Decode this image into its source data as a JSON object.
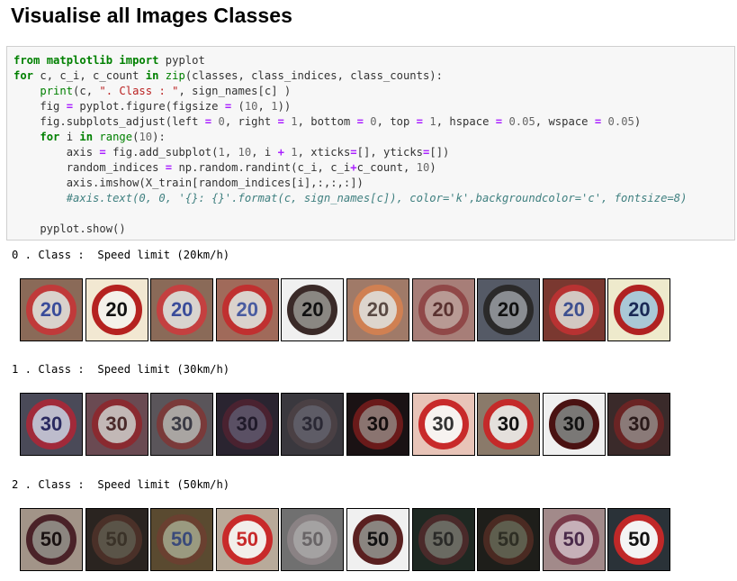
{
  "heading": "Visualise all Images Classes",
  "code_lines": [
    "from matplotlib import pyplot",
    "for c, c_i, c_count in zip(classes, class_indices, class_counts):",
    "    print(c, \". Class : \", sign_names[c] )",
    "    fig = pyplot.figure(figsize = (10, 1))",
    "    fig.subplots_adjust(left = 0, right = 1, bottom = 0, top = 1, hspace = 0.05, wspace = 0.05)",
    "    for i in range(10):",
    "        axis = fig.add_subplot(1, 10, i + 1, xticks=[], yticks=[])",
    "        random_indices = np.random.randint(c_i, c_i+c_count, 10)",
    "        axis.imshow(X_train[random_indices[i],:,:,:])",
    "        #axis.text(0, 0, '{}: {}'.format(c, sign_names[c]), color='k',backgroundcolor='c', fontsize=8)",
    "",
    "    pyplot.show()"
  ],
  "outputs": [
    {
      "text": "0 . Class :  Speed limit (20km/h)",
      "images": [
        {
          "label": "20",
          "bg": "#8a6a58",
          "ring": "#c03a3a",
          "face": "#d9d2cc",
          "fg": "#3a4c9a",
          "border": "#000000"
        },
        {
          "label": "20",
          "bg": "#f2e8d2",
          "ring": "#b52220",
          "face": "#f4f1ea",
          "fg": "#111111",
          "border": "#000000"
        },
        {
          "label": "20",
          "bg": "#8a6a58",
          "ring": "#c44040",
          "face": "#d8d4cf",
          "fg": "#3a4c9a",
          "border": "#000000"
        },
        {
          "label": "20",
          "bg": "#a06a5a",
          "ring": "#c03030",
          "face": "#dad2cc",
          "fg": "#4a5ca0",
          "border": "#000000"
        },
        {
          "label": "20",
          "bg": "#f0f0f0",
          "ring": "#3a2a28",
          "face": "#8a8782",
          "fg": "#111111",
          "border": "#000000"
        },
        {
          "label": "20",
          "bg": "#a07a68",
          "ring": "#d08052",
          "face": "#ddd5cd",
          "fg": "#5a4a44",
          "border": "#000000"
        },
        {
          "label": "20",
          "bg": "#a77e78",
          "ring": "#904848",
          "face": "#b89a94",
          "fg": "#5a3230",
          "border": "#000000"
        },
        {
          "label": "20",
          "bg": "#555a66",
          "ring": "#2b2a2a",
          "face": "#8a8d92",
          "fg": "#111111",
          "border": "#000000"
        },
        {
          "label": "20",
          "bg": "#7a3830",
          "ring": "#b83232",
          "face": "#d2c8c2",
          "fg": "#3e5090",
          "border": "#000000"
        },
        {
          "label": "20",
          "bg": "#eeeacc",
          "ring": "#b02222",
          "face": "#aac8d6",
          "fg": "#1a2a55",
          "border": "#000000"
        }
      ]
    },
    {
      "text": "1 . Class :  Speed limit (30km/h)",
      "images": [
        {
          "label": "30",
          "bg": "#4a4a58",
          "ring": "#a12a3a",
          "face": "#bdbccc",
          "fg": "#2a2a60",
          "border": "#000000"
        },
        {
          "label": "30",
          "bg": "#6a4a52",
          "ring": "#8a2a30",
          "face": "#c2b8b6",
          "fg": "#4a2a2a",
          "border": "#000000"
        },
        {
          "label": "30",
          "bg": "#5a555a",
          "ring": "#7a3a3a",
          "face": "#a9a5a2",
          "fg": "#3a3a44",
          "border": "#000000"
        },
        {
          "label": "30",
          "bg": "#2a2430",
          "ring": "#4a2230",
          "face": "#5a5064",
          "fg": "#201a2a",
          "border": "#000000"
        },
        {
          "label": "30",
          "bg": "#3a383e",
          "ring": "#4a4044",
          "face": "#5e5c66",
          "fg": "#2a2834",
          "border": "#000000"
        },
        {
          "label": "30",
          "bg": "#1a1214",
          "ring": "#6a1a1a",
          "face": "#8a7470",
          "fg": "#140e0e",
          "border": "#000000"
        },
        {
          "label": "30",
          "bg": "#e8c4b8",
          "ring": "#c82a2a",
          "face": "#f7f3f0",
          "fg": "#333333",
          "border": "#000000"
        },
        {
          "label": "30",
          "bg": "#8a7a6a",
          "ring": "#c42a2a",
          "face": "#e4e0dc",
          "fg": "#111111",
          "border": "#000000"
        },
        {
          "label": "30",
          "bg": "#f0f0f0",
          "ring": "#4a1212",
          "face": "#7a7876",
          "fg": "#111111",
          "border": "#000000"
        },
        {
          "label": "30",
          "bg": "#3a2a2a",
          "ring": "#6a2424",
          "face": "#8a7a78",
          "fg": "#2a1a1a",
          "border": "#000000"
        }
      ]
    },
    {
      "text": "2 . Class :  Speed limit (50km/h)",
      "images": [
        {
          "label": "50",
          "bg": "#a29488",
          "ring": "#4a2228",
          "face": "#8c8680",
          "fg": "#1a1212",
          "border": "#000000"
        },
        {
          "label": "50",
          "bg": "#2a2420",
          "ring": "#4a3028",
          "face": "#5a5448",
          "fg": "#3a3228",
          "border": "#000000"
        },
        {
          "label": "50",
          "bg": "#5a4a30",
          "ring": "#6a4030",
          "face": "#9a9a80",
          "fg": "#3a4a7a",
          "border": "#000000"
        },
        {
          "label": "50",
          "bg": "#b8aa9a",
          "ring": "#c82a2a",
          "face": "#f2eeea",
          "fg": "#c82a2a",
          "border": "#000000"
        },
        {
          "label": "50",
          "bg": "#707070",
          "ring": "#8a8284",
          "face": "#a4a2a2",
          "fg": "#686466",
          "border": "#000000"
        },
        {
          "label": "50",
          "bg": "#f0f0f0",
          "ring": "#5a2020",
          "face": "#8a8580",
          "fg": "#111111",
          "border": "#000000"
        },
        {
          "label": "50",
          "bg": "#1e2822",
          "ring": "#4a2a2a",
          "face": "#6a6a62",
          "fg": "#2a2a28",
          "border": "#000000"
        },
        {
          "label": "50",
          "bg": "#1e1e1a",
          "ring": "#4a2a22",
          "face": "#5e5e4e",
          "fg": "#2e2e24",
          "border": "#000000"
        },
        {
          "label": "50",
          "bg": "#a28a8a",
          "ring": "#7a3a4a",
          "face": "#c6b0b8",
          "fg": "#4a2a4a",
          "border": "#000000"
        },
        {
          "label": "50",
          "bg": "#2a3238",
          "ring": "#c02828",
          "face": "#f4f4f4",
          "fg": "#111111",
          "border": "#000000"
        }
      ]
    }
  ]
}
